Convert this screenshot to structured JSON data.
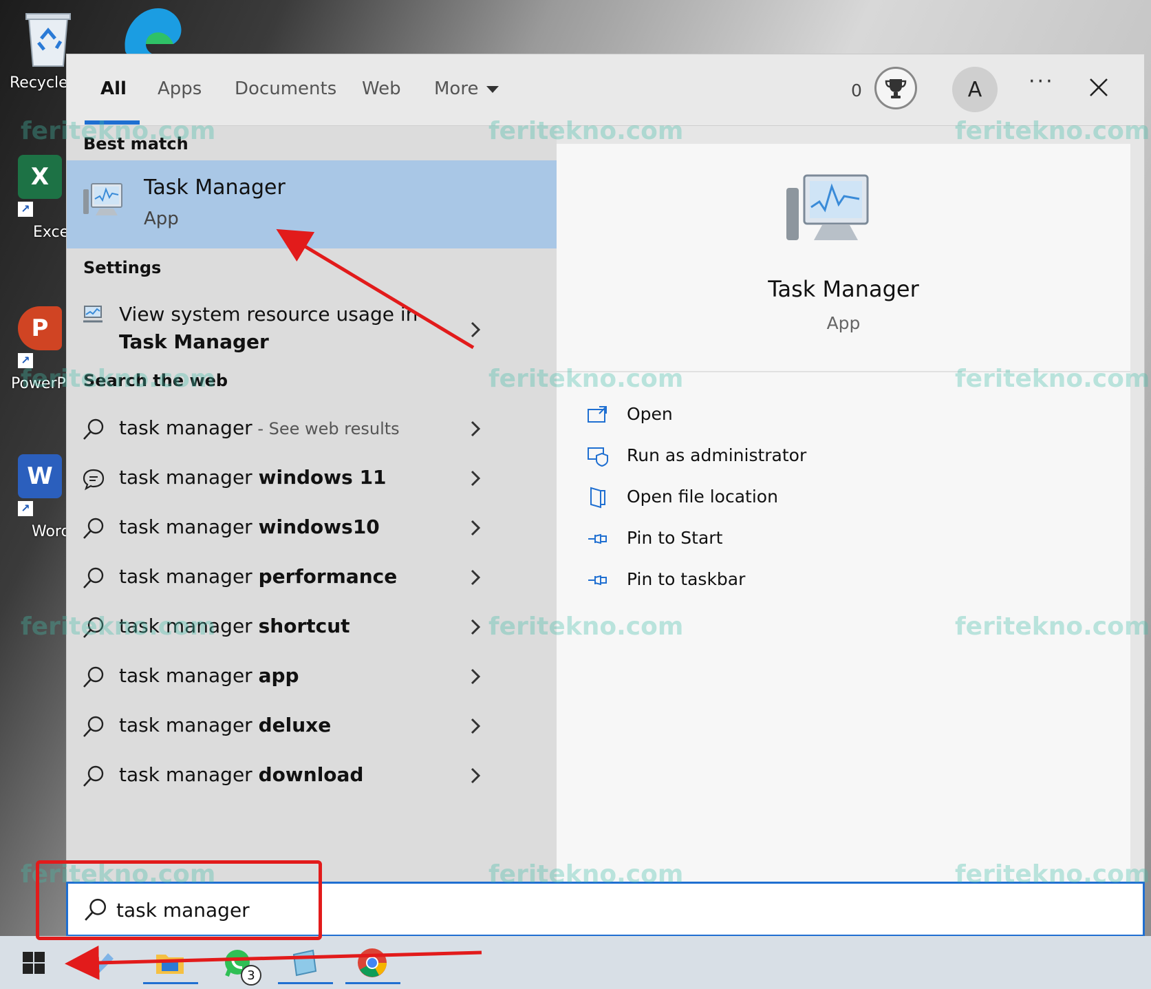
{
  "desktop": {
    "icons": [
      {
        "label": "Recycle",
        "icon": "recycle-bin-icon"
      },
      {
        "label": "Exce",
        "icon": "excel-icon",
        "glyph": "X",
        "color": "#1d7245"
      },
      {
        "label": "PowerP",
        "icon": "powerpoint-icon",
        "glyph": "P",
        "color": "#d04423"
      },
      {
        "label": "Word",
        "icon": "word-icon",
        "glyph": "W",
        "color": "#2b5fbd"
      }
    ]
  },
  "search_panel": {
    "tabs": [
      {
        "label": "All",
        "active": true
      },
      {
        "label": "Apps"
      },
      {
        "label": "Documents"
      },
      {
        "label": "Web"
      },
      {
        "label": "More"
      }
    ],
    "points": "0",
    "avatar_initial": "A",
    "ellipsis": "···",
    "best_match": {
      "section": "Best match",
      "name": "Task Manager",
      "type": "App"
    },
    "settings": {
      "section": "Settings",
      "item_prefix": "View system resource usage in ",
      "item_bold": "Task Manager"
    },
    "web": {
      "section": "Search the web",
      "query": "task manager",
      "first_hint": " - See web results",
      "suggestions": [
        {
          "bold": "windows 11",
          "icon": "chat-icon"
        },
        {
          "bold": "windows10",
          "icon": "search-icon"
        },
        {
          "bold": "performance",
          "icon": "search-icon"
        },
        {
          "bold": "shortcut",
          "icon": "search-icon"
        },
        {
          "bold": "app",
          "icon": "search-icon"
        },
        {
          "bold": "deluxe",
          "icon": "search-icon"
        },
        {
          "bold": "download",
          "icon": "search-icon"
        }
      ]
    },
    "preview": {
      "name": "Task Manager",
      "type": "App",
      "actions": [
        {
          "label": "Open",
          "icon": "open-window-icon"
        },
        {
          "label": "Run as administrator",
          "icon": "shield-icon"
        },
        {
          "label": "Open file location",
          "icon": "folder-icon"
        },
        {
          "label": "Pin to Start",
          "icon": "pin-icon"
        },
        {
          "label": "Pin to taskbar",
          "icon": "pin-icon"
        }
      ]
    }
  },
  "searchbar": {
    "value": "task manager"
  },
  "taskbar": {
    "whatsapp_badge": "3"
  },
  "watermark": "feritekno.com",
  "colors": {
    "accent": "#1f6fd1",
    "selection": "#a9c7e6",
    "annotation_red": "#e21b1b"
  }
}
